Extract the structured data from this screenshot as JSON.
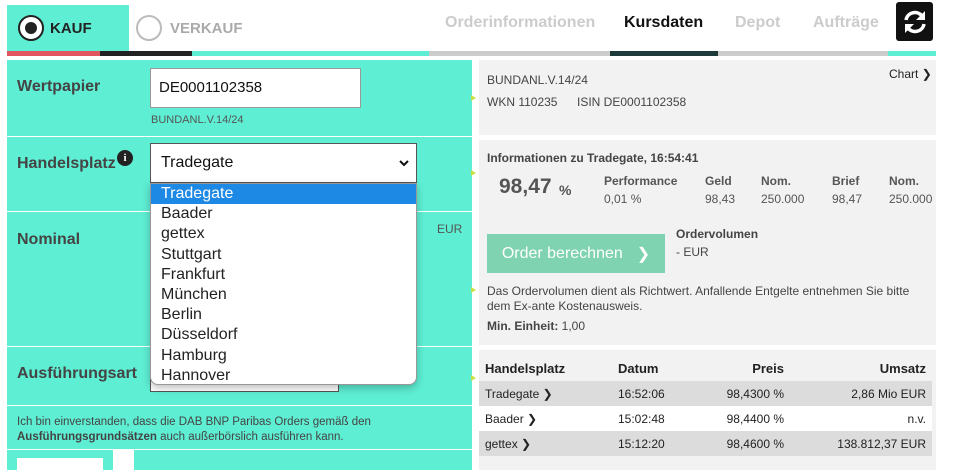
{
  "tabs": {
    "kauf": "KAUF",
    "verkauf": "VERKAUF"
  },
  "nav": {
    "orderinfo": "Orderinformationen",
    "kursdaten": "Kursdaten",
    "depot": "Depot",
    "auftraege": "Aufträge"
  },
  "form": {
    "wertpapier_label": "Wertpapier",
    "wertpapier_value": "DE0001102358",
    "wertpapier_name": "BUNDANL.V.14/24",
    "handelsplatz_label": "Handelsplatz",
    "handelsplatz_selected": "Tradegate",
    "handelsplatz_options": [
      "Tradegate",
      "Baader",
      "gettex",
      "Stuttgart",
      "Frankfurt",
      "München",
      "Berlin",
      "Düsseldorf",
      "Hamburg",
      "Hannover"
    ],
    "nominal_label": "Nominal",
    "nominal_unit": "EUR",
    "ausfuehrungsart_label": "Ausführungsart",
    "consent_text_1": "Ich bin einverstanden, dass die DAB BNP Paribas Orders gemäß den",
    "consent_bold": "Ausführungsgrundsätzen",
    "consent_text_2": " auch außerbörslich ausführen kann."
  },
  "security": {
    "name": "BUNDANL.V.14/24",
    "wkn": "WKN 110235",
    "isin": "ISIN DE0001102358",
    "chart_link": "Chart"
  },
  "quote": {
    "info_title": "Informationen zu Tradegate, 16:54:41",
    "price": "98,47",
    "price_unit": "%",
    "performance_label": "Performance",
    "performance_value": "0,01 %",
    "geld_label": "Geld",
    "geld_value": "98,43",
    "nom1_label": "Nom.",
    "nom1_value": "250.000",
    "brief_label": "Brief",
    "brief_value": "98,47",
    "nom2_label": "Nom.",
    "nom2_value": "250.000"
  },
  "order": {
    "button_label": "Order berechnen",
    "volume_label": "Ordervolumen",
    "volume_value": "- EUR",
    "note": "Das Ordervolumen dient als Richtwert. Anfallende Entgelte entnehmen Sie bitte dem Ex-ante Kostenausweis.",
    "min_unit_label": "Min. Einheit:",
    "min_unit_value": "1,00"
  },
  "table": {
    "headers": [
      "Handelsplatz",
      "Datum",
      "Preis",
      "Umsatz"
    ],
    "rows": [
      {
        "platz": "Tradegate",
        "datum": "16:52:06",
        "preis": "98,4300 %",
        "umsatz": "2,86 Mio EUR"
      },
      {
        "platz": "Baader",
        "datum": "15:02:48",
        "preis": "98,4400 %",
        "umsatz": "n.v."
      },
      {
        "platz": "gettex",
        "datum": "15:12:20",
        "preis": "98,4600 %",
        "umsatz": "138.812,37 EUR"
      }
    ]
  },
  "colors": {
    "accent": "#5eeed3",
    "danger": "#e0555f",
    "button": "#7fd3b0",
    "selected_option": "#1e88e5"
  }
}
